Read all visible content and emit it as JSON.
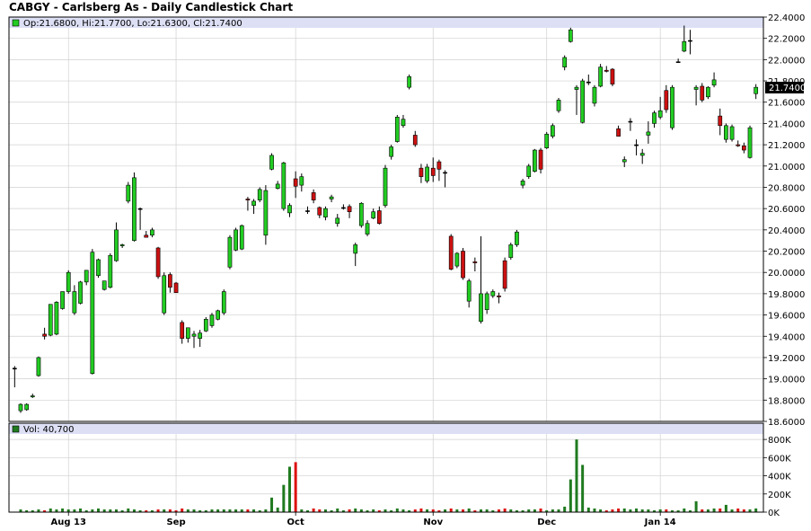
{
  "chart_data": {
    "type": "candlestick",
    "title": "CABGY - Carlsberg As - Daily Candlestick Chart",
    "ohlc_legend": "Op:21.6800, Hi:21.7700, Lo:21.6300, Cl:21.7400",
    "last_price_label": "21.7400",
    "vol_legend": "Vol: 40,700",
    "price_axis": {
      "min": 18.6,
      "max": 22.4,
      "ticks": [
        "22.4000",
        "22.2000",
        "22.0000",
        "21.8000",
        "21.6000",
        "21.4000",
        "21.2000",
        "21.0000",
        "20.8000",
        "20.6000",
        "20.4000",
        "20.2000",
        "20.0000",
        "19.8000",
        "19.6000",
        "19.4000",
        "19.2000",
        "19.0000",
        "18.8000",
        "18.6000"
      ]
    },
    "volume_axis": {
      "min": 0,
      "max": 900000,
      "ticks": [
        "800K",
        "600K",
        "400K",
        "200K",
        "0K"
      ]
    },
    "x_labels": [
      {
        "label": "Aug 13",
        "i": 9
      },
      {
        "label": "Sep",
        "i": 27
      },
      {
        "label": "Oct",
        "i": 47
      },
      {
        "label": "Nov",
        "i": 70
      },
      {
        "label": "Dec",
        "i": 89
      },
      {
        "label": "Jan 14",
        "i": 108
      }
    ],
    "colors": {
      "up": "#22cc22",
      "down": "#cc1111",
      "neutral": "#000000",
      "vol_up": "#1f7a1f",
      "vol_down": "#dd1111",
      "header_band": "#dde0f5",
      "grid": "#d0d0d0",
      "price_tag": "#000000"
    },
    "candles": [
      {
        "o": 19.1,
        "h": 19.12,
        "l": 18.92,
        "c": 19.1,
        "v": 5000
      },
      {
        "o": 18.7,
        "h": 18.77,
        "l": 18.68,
        "c": 18.76,
        "v": 30000
      },
      {
        "o": 18.71,
        "h": 18.77,
        "l": 18.7,
        "c": 18.76,
        "v": 20000
      },
      {
        "o": 18.83,
        "h": 18.86,
        "l": 18.82,
        "c": 18.84,
        "v": 20000
      },
      {
        "o": 19.03,
        "h": 19.21,
        "l": 19.02,
        "c": 19.2,
        "v": 30000
      },
      {
        "o": 19.42,
        "h": 19.48,
        "l": 19.37,
        "c": 19.4,
        "v": 20000
      },
      {
        "o": 19.41,
        "h": 19.7,
        "l": 19.4,
        "c": 19.7,
        "v": 40000
      },
      {
        "o": 19.42,
        "h": 19.73,
        "l": 19.41,
        "c": 19.72,
        "v": 30000
      },
      {
        "o": 19.66,
        "h": 19.82,
        "l": 19.65,
        "c": 19.82,
        "v": 40000
      },
      {
        "o": 19.82,
        "h": 20.02,
        "l": 19.8,
        "c": 20.0,
        "v": 30000
      },
      {
        "o": 19.62,
        "h": 19.88,
        "l": 19.6,
        "c": 19.82,
        "v": 30000
      },
      {
        "o": 19.71,
        "h": 19.92,
        "l": 19.7,
        "c": 19.91,
        "v": 40000
      },
      {
        "o": 19.91,
        "h": 20.02,
        "l": 19.88,
        "c": 20.02,
        "v": 20000
      },
      {
        "o": 19.05,
        "h": 20.22,
        "l": 19.04,
        "c": 20.19,
        "v": 30000
      },
      {
        "o": 19.97,
        "h": 20.13,
        "l": 19.95,
        "c": 20.12,
        "v": 40000
      },
      {
        "o": 19.84,
        "h": 19.92,
        "l": 19.83,
        "c": 19.92,
        "v": 30000
      },
      {
        "o": 19.86,
        "h": 20.18,
        "l": 19.85,
        "c": 20.16,
        "v": 30000
      },
      {
        "o": 20.11,
        "h": 20.47,
        "l": 20.1,
        "c": 20.4,
        "v": 30000
      },
      {
        "o": 20.25,
        "h": 20.27,
        "l": 20.23,
        "c": 20.26,
        "v": 20000
      },
      {
        "o": 20.67,
        "h": 20.85,
        "l": 20.65,
        "c": 20.82,
        "v": 40000
      },
      {
        "o": 20.3,
        "h": 20.94,
        "l": 20.29,
        "c": 20.89,
        "v": 30000
      },
      {
        "o": 20.6,
        "h": 20.61,
        "l": 20.4,
        "c": 20.6,
        "v": 20000
      },
      {
        "o": 20.35,
        "h": 20.39,
        "l": 20.33,
        "c": 20.33,
        "v": 20000
      },
      {
        "o": 20.35,
        "h": 20.42,
        "l": 20.33,
        "c": 20.4,
        "v": 20000
      },
      {
        "o": 20.23,
        "h": 20.24,
        "l": 19.94,
        "c": 19.96,
        "v": 30000
      },
      {
        "o": 19.62,
        "h": 20.0,
        "l": 19.6,
        "c": 19.97,
        "v": 30000
      },
      {
        "o": 19.98,
        "h": 20.0,
        "l": 19.81,
        "c": 19.86,
        "v": 30000
      },
      {
        "o": 19.9,
        "h": 19.91,
        "l": 19.81,
        "c": 19.81,
        "v": 20000
      },
      {
        "o": 19.53,
        "h": 19.55,
        "l": 19.33,
        "c": 19.38,
        "v": 40000
      },
      {
        "o": 19.38,
        "h": 19.48,
        "l": 19.34,
        "c": 19.48,
        "v": 30000
      },
      {
        "o": 19.4,
        "h": 19.45,
        "l": 19.29,
        "c": 19.42,
        "v": 30000
      },
      {
        "o": 19.38,
        "h": 19.46,
        "l": 19.3,
        "c": 19.43,
        "v": 20000
      },
      {
        "o": 19.45,
        "h": 19.58,
        "l": 19.44,
        "c": 19.56,
        "v": 20000
      },
      {
        "o": 19.5,
        "h": 19.62,
        "l": 19.48,
        "c": 19.6,
        "v": 30000
      },
      {
        "o": 19.56,
        "h": 19.65,
        "l": 19.55,
        "c": 19.64,
        "v": 30000
      },
      {
        "o": 19.62,
        "h": 19.84,
        "l": 19.6,
        "c": 19.82,
        "v": 30000
      },
      {
        "o": 20.05,
        "h": 20.35,
        "l": 20.03,
        "c": 20.33,
        "v": 30000
      },
      {
        "o": 20.21,
        "h": 20.42,
        "l": 20.2,
        "c": 20.4,
        "v": 30000
      },
      {
        "o": 20.22,
        "h": 20.45,
        "l": 20.21,
        "c": 20.44,
        "v": 30000
      },
      {
        "o": 20.69,
        "h": 20.71,
        "l": 20.58,
        "c": 20.68,
        "v": 30000
      },
      {
        "o": 20.63,
        "h": 20.69,
        "l": 20.55,
        "c": 20.67,
        "v": 30000
      },
      {
        "o": 20.68,
        "h": 20.8,
        "l": 20.66,
        "c": 20.78,
        "v": 20000
      },
      {
        "o": 20.35,
        "h": 20.82,
        "l": 20.26,
        "c": 20.77,
        "v": 30000
      },
      {
        "o": 20.97,
        "h": 21.12,
        "l": 20.96,
        "c": 21.1,
        "v": 160000
      },
      {
        "o": 20.79,
        "h": 20.86,
        "l": 20.78,
        "c": 20.83,
        "v": 50000
      },
      {
        "o": 20.6,
        "h": 21.04,
        "l": 20.58,
        "c": 21.03,
        "v": 300000
      },
      {
        "o": 20.56,
        "h": 20.65,
        "l": 20.52,
        "c": 20.63,
        "v": 500000
      },
      {
        "o": 20.88,
        "h": 20.95,
        "l": 20.7,
        "c": 20.81,
        "v": 550000
      },
      {
        "o": 20.82,
        "h": 20.93,
        "l": 20.76,
        "c": 20.9,
        "v": 30000
      },
      {
        "o": 20.58,
        "h": 20.62,
        "l": 20.55,
        "c": 20.58,
        "v": 20000
      },
      {
        "o": 20.75,
        "h": 20.78,
        "l": 20.65,
        "c": 20.68,
        "v": 40000
      },
      {
        "o": 20.61,
        "h": 20.62,
        "l": 20.51,
        "c": 20.54,
        "v": 30000
      },
      {
        "o": 20.52,
        "h": 20.62,
        "l": 20.49,
        "c": 20.6,
        "v": 30000
      },
      {
        "o": 20.69,
        "h": 20.73,
        "l": 20.66,
        "c": 20.71,
        "v": 20000
      },
      {
        "o": 20.46,
        "h": 20.55,
        "l": 20.43,
        "c": 20.51,
        "v": 40000
      },
      {
        "o": 20.61,
        "h": 20.64,
        "l": 20.59,
        "c": 20.61,
        "v": 20000
      },
      {
        "o": 20.62,
        "h": 20.64,
        "l": 20.51,
        "c": 20.57,
        "v": 30000
      },
      {
        "o": 20.18,
        "h": 20.28,
        "l": 20.06,
        "c": 20.26,
        "v": 40000
      },
      {
        "o": 20.44,
        "h": 20.66,
        "l": 20.42,
        "c": 20.65,
        "v": 30000
      },
      {
        "o": 20.36,
        "h": 20.49,
        "l": 20.34,
        "c": 20.46,
        "v": 20000
      },
      {
        "o": 20.51,
        "h": 20.6,
        "l": 20.5,
        "c": 20.57,
        "v": 30000
      },
      {
        "o": 20.58,
        "h": 20.62,
        "l": 20.45,
        "c": 20.46,
        "v": 20000
      },
      {
        "o": 20.63,
        "h": 21.01,
        "l": 20.61,
        "c": 20.98,
        "v": 30000
      },
      {
        "o": 21.09,
        "h": 21.2,
        "l": 21.06,
        "c": 21.18,
        "v": 20000
      },
      {
        "o": 21.23,
        "h": 21.48,
        "l": 21.22,
        "c": 21.46,
        "v": 40000
      },
      {
        "o": 21.38,
        "h": 21.48,
        "l": 21.36,
        "c": 21.44,
        "v": 30000
      },
      {
        "o": 21.74,
        "h": 21.86,
        "l": 21.72,
        "c": 21.84,
        "v": 20000
      },
      {
        "o": 21.29,
        "h": 21.33,
        "l": 21.18,
        "c": 21.2,
        "v": 30000
      },
      {
        "o": 20.98,
        "h": 21.02,
        "l": 20.84,
        "c": 20.9,
        "v": 40000
      },
      {
        "o": 20.86,
        "h": 21.02,
        "l": 20.84,
        "c": 20.99,
        "v": 30000
      },
      {
        "o": 20.98,
        "h": 21.08,
        "l": 20.85,
        "c": 20.91,
        "v": 30000
      },
      {
        "o": 21.04,
        "h": 21.06,
        "l": 20.86,
        "c": 20.97,
        "v": 20000
      },
      {
        "o": 20.94,
        "h": 20.96,
        "l": 20.8,
        "c": 20.94,
        "v": 30000
      },
      {
        "o": 20.34,
        "h": 20.36,
        "l": 20.02,
        "c": 20.03,
        "v": 40000
      },
      {
        "o": 20.06,
        "h": 20.19,
        "l": 20.04,
        "c": 20.18,
        "v": 30000
      },
      {
        "o": 20.2,
        "h": 20.23,
        "l": 19.93,
        "c": 19.95,
        "v": 30000
      },
      {
        "o": 19.73,
        "h": 19.94,
        "l": 19.67,
        "c": 19.92,
        "v": 40000
      },
      {
        "o": 20.1,
        "h": 20.14,
        "l": 20.01,
        "c": 20.09,
        "v": 20000
      },
      {
        "o": 19.54,
        "h": 20.34,
        "l": 19.52,
        "c": 19.8,
        "v": 30000
      },
      {
        "o": 19.65,
        "h": 19.82,
        "l": 19.61,
        "c": 19.8,
        "v": 30000
      },
      {
        "o": 19.78,
        "h": 19.84,
        "l": 19.76,
        "c": 19.82,
        "v": 20000
      },
      {
        "o": 19.78,
        "h": 19.81,
        "l": 19.71,
        "c": 19.77,
        "v": 30000
      },
      {
        "o": 20.11,
        "h": 20.14,
        "l": 19.82,
        "c": 19.85,
        "v": 40000
      },
      {
        "o": 20.14,
        "h": 20.28,
        "l": 20.12,
        "c": 20.26,
        "v": 30000
      },
      {
        "o": 20.26,
        "h": 20.4,
        "l": 20.24,
        "c": 20.38,
        "v": 20000
      },
      {
        "o": 20.82,
        "h": 20.88,
        "l": 20.79,
        "c": 20.86,
        "v": 20000
      },
      {
        "o": 20.9,
        "h": 21.02,
        "l": 20.88,
        "c": 21.0,
        "v": 30000
      },
      {
        "o": 20.95,
        "h": 21.16,
        "l": 20.94,
        "c": 21.15,
        "v": 30000
      },
      {
        "o": 21.15,
        "h": 21.17,
        "l": 20.93,
        "c": 20.97,
        "v": 40000
      },
      {
        "o": 21.17,
        "h": 21.32,
        "l": 21.16,
        "c": 21.3,
        "v": 20000
      },
      {
        "o": 21.28,
        "h": 21.4,
        "l": 21.26,
        "c": 21.38,
        "v": 30000
      },
      {
        "o": 21.52,
        "h": 21.64,
        "l": 21.5,
        "c": 21.62,
        "v": 30000
      },
      {
        "o": 21.93,
        "h": 22.04,
        "l": 21.9,
        "c": 22.02,
        "v": 60000
      },
      {
        "o": 22.17,
        "h": 22.3,
        "l": 22.16,
        "c": 22.28,
        "v": 360000
      },
      {
        "o": 21.72,
        "h": 21.76,
        "l": 21.48,
        "c": 21.74,
        "v": 800000
      },
      {
        "o": 21.41,
        "h": 21.82,
        "l": 21.4,
        "c": 21.8,
        "v": 520000
      },
      {
        "o": 21.79,
        "h": 21.86,
        "l": 21.76,
        "c": 21.79,
        "v": 50000
      },
      {
        "o": 21.59,
        "h": 21.76,
        "l": 21.56,
        "c": 21.74,
        "v": 40000
      },
      {
        "o": 21.75,
        "h": 21.96,
        "l": 21.74,
        "c": 21.93,
        "v": 30000
      },
      {
        "o": 21.9,
        "h": 21.94,
        "l": 21.88,
        "c": 21.89,
        "v": 20000
      },
      {
        "o": 21.91,
        "h": 21.92,
        "l": 21.75,
        "c": 21.77,
        "v": 30000
      },
      {
        "o": 21.35,
        "h": 21.38,
        "l": 21.28,
        "c": 21.28,
        "v": 40000
      },
      {
        "o": 21.04,
        "h": 21.09,
        "l": 20.99,
        "c": 21.06,
        "v": 40000
      },
      {
        "o": 21.42,
        "h": 21.45,
        "l": 21.33,
        "c": 21.42,
        "v": 30000
      },
      {
        "o": 21.2,
        "h": 21.25,
        "l": 21.1,
        "c": 21.2,
        "v": 40000
      },
      {
        "o": 21.1,
        "h": 21.16,
        "l": 21.02,
        "c": 21.12,
        "v": 30000
      },
      {
        "o": 21.29,
        "h": 21.42,
        "l": 21.21,
        "c": 21.32,
        "v": 30000
      },
      {
        "o": 21.4,
        "h": 21.52,
        "l": 21.36,
        "c": 21.5,
        "v": 20000
      },
      {
        "o": 21.46,
        "h": 21.65,
        "l": 21.44,
        "c": 21.52,
        "v": 30000
      },
      {
        "o": 21.71,
        "h": 21.76,
        "l": 21.5,
        "c": 21.53,
        "v": 30000
      },
      {
        "o": 21.36,
        "h": 21.76,
        "l": 21.34,
        "c": 21.74,
        "v": 20000
      },
      {
        "o": 21.98,
        "h": 22.01,
        "l": 21.97,
        "c": 21.98,
        "v": 20000
      },
      {
        "o": 22.08,
        "h": 22.32,
        "l": 22.07,
        "c": 22.17,
        "v": 40000
      },
      {
        "o": 22.18,
        "h": 22.28,
        "l": 22.05,
        "c": 22.18,
        "v": 20000
      },
      {
        "o": 21.72,
        "h": 21.76,
        "l": 21.57,
        "c": 21.74,
        "v": 120000
      },
      {
        "o": 21.75,
        "h": 21.78,
        "l": 21.6,
        "c": 21.62,
        "v": 30000
      },
      {
        "o": 21.65,
        "h": 21.75,
        "l": 21.63,
        "c": 21.74,
        "v": 30000
      },
      {
        "o": 21.76,
        "h": 21.88,
        "l": 21.74,
        "c": 21.81,
        "v": 40000
      },
      {
        "o": 21.47,
        "h": 21.54,
        "l": 21.29,
        "c": 21.38,
        "v": 40000
      },
      {
        "o": 21.25,
        "h": 21.4,
        "l": 21.22,
        "c": 21.38,
        "v": 80000
      },
      {
        "o": 21.25,
        "h": 21.39,
        "l": 21.23,
        "c": 21.37,
        "v": 30000
      },
      {
        "o": 21.2,
        "h": 21.24,
        "l": 21.18,
        "c": 21.19,
        "v": 40000
      },
      {
        "o": 21.19,
        "h": 21.22,
        "l": 21.12,
        "c": 21.15,
        "v": 30000
      },
      {
        "o": 21.08,
        "h": 21.38,
        "l": 21.07,
        "c": 21.36,
        "v": 30000
      },
      {
        "o": 21.68,
        "h": 21.77,
        "l": 21.63,
        "c": 21.74,
        "v": 40700
      }
    ]
  }
}
